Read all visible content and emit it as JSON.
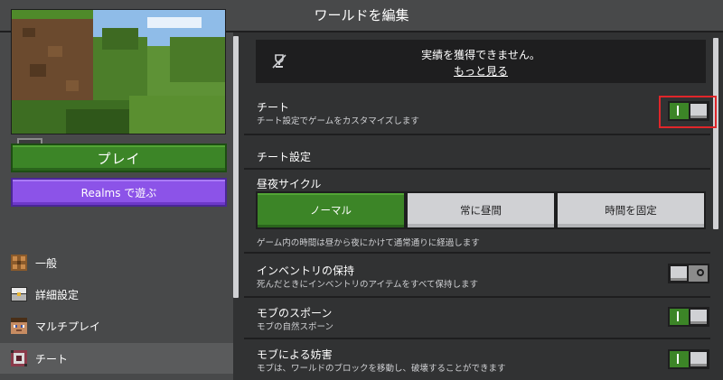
{
  "header": {
    "title": "ワールドを編集"
  },
  "sidebar": {
    "play_label": "プレイ",
    "realms_label": "Realms で遊ぶ",
    "items": [
      {
        "label": "一般",
        "icon": "crafting-table-icon"
      },
      {
        "label": "詳細設定",
        "icon": "chest-icon"
      },
      {
        "label": "マルチプレイ",
        "icon": "steve-icon"
      },
      {
        "label": "チート",
        "icon": "command-block-icon",
        "selected": true
      }
    ]
  },
  "banner": {
    "message": "実績を獲得できません。",
    "link": "もっと見る"
  },
  "cheats": {
    "title": "チート",
    "description": "チート設定でゲームをカスタマイズします",
    "enabled": true
  },
  "cheat_settings": {
    "heading": "チート設定",
    "day_cycle": {
      "title": "昼夜サイクル",
      "options": [
        "ノーマル",
        "常に昼間",
        "時間を固定"
      ],
      "selected": "ノーマル",
      "description": "ゲーム内の時間は昼から夜にかけて通常通りに経過します"
    },
    "keep_inventory": {
      "title": "インベントリの保持",
      "description": "死んだときにインベントリのアイテムをすべて保持します",
      "enabled": false
    },
    "mob_spawning": {
      "title": "モブのスポーン",
      "description": "モブの自然スポーン",
      "enabled": true
    },
    "mob_griefing": {
      "title": "モブによる妨害",
      "description": "モブは、ワールドのブロックを移動し、破壊することができます",
      "enabled": true
    }
  },
  "colors": {
    "accent_green": "#3c8527",
    "realms_purple": "#8c53e8",
    "highlight_red": "#e0262a"
  }
}
